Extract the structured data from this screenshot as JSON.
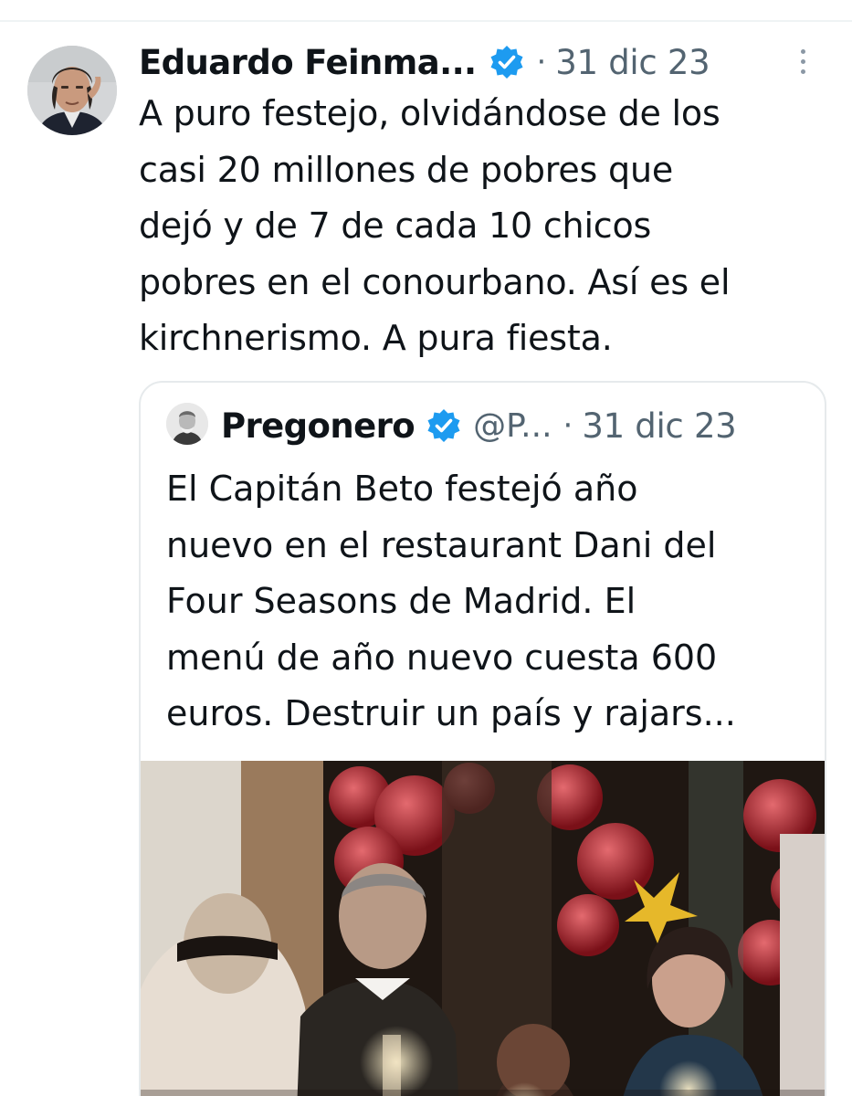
{
  "tweet": {
    "author_name": "Eduardo Feinma...",
    "separator": "·",
    "date": "31 dic 23",
    "text_lines": [
      "A puro festejo, olvidándose de los",
      "casi 20 millones de pobres que",
      "dejó y de 7 de cada 10 chicos",
      "pobres en el conourbano. Así es el",
      "kirchnerismo. A pura fiesta."
    ]
  },
  "quote": {
    "author_name": "Pregonero",
    "handle": "@P...",
    "separator": "·",
    "date": "31 dic 23",
    "text_lines": [
      "El Capitán Beto festejó año",
      "nuevo en el restaurant Dani del",
      "Four Seasons de Madrid.  El",
      "menú de año nuevo cuesta 600",
      "euros.  Destruir un país y rajars..."
    ]
  },
  "icons": {
    "verified": "verified-badge-icon",
    "more": "more-options-icon"
  },
  "colors": {
    "text_primary": "#0f1419",
    "text_secondary": "#536471",
    "verified_blue": "#1d9bf0",
    "border": "#e6eaec"
  }
}
